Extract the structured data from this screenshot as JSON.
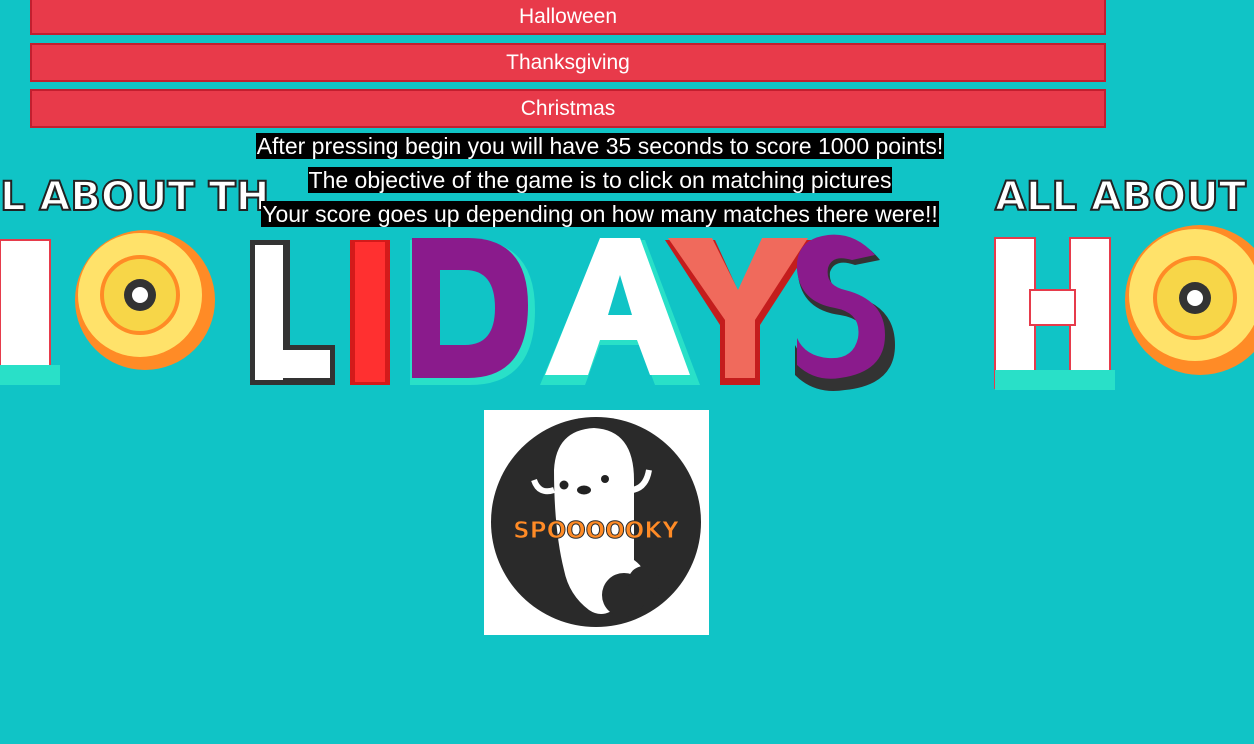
{
  "buttons": {
    "halloween": "Halloween",
    "thanksgiving": "Thanksgiving",
    "christmas": "Christmas"
  },
  "instructions": [
    "After pressing begin you will have 35 seconds to score 1000 points!",
    "The objective of the game is to click on matching pictures",
    "Your score goes up depending on how many matches there were!!"
  ],
  "banner": {
    "top_text_left": "L ABOUT TH",
    "top_text_right": "ALL ABOUT",
    "main_text": "HOLIDAYS",
    "right_text": "HO"
  },
  "card": {
    "label": "SPOOOOOKY"
  },
  "colors": {
    "background": "#10c4c6",
    "button": "#e83a4a",
    "button_border": "#c21f2f",
    "instruction_bg": "#000000",
    "instruction_text": "#ffffff"
  }
}
